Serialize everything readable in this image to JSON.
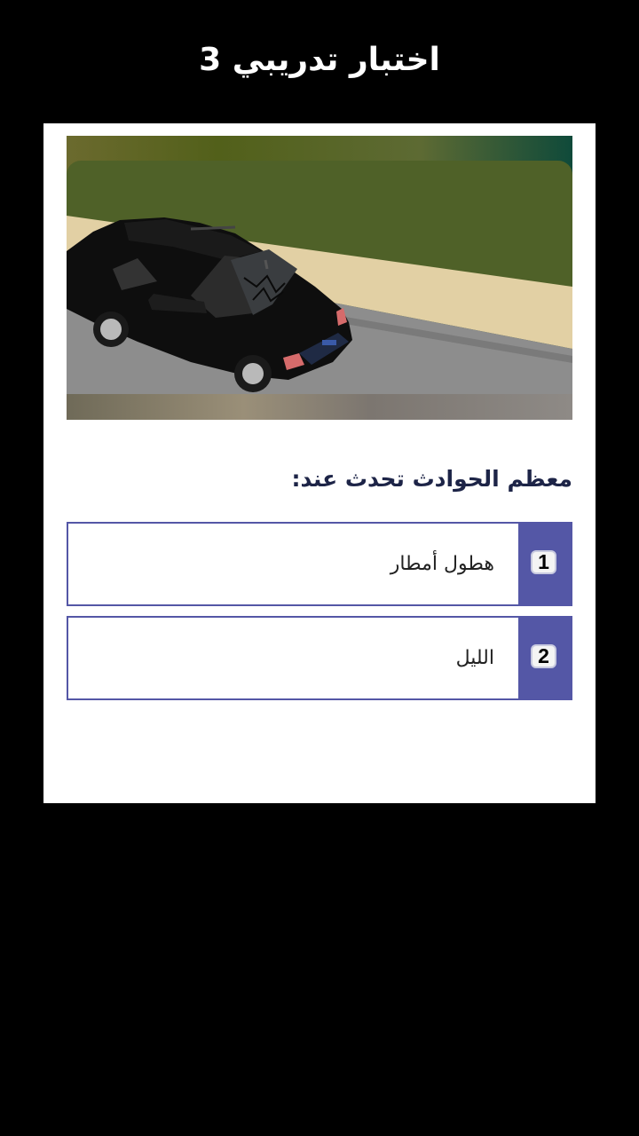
{
  "header": {
    "title": "اختبار تدريبي 3"
  },
  "quiz": {
    "illustration": "black-car-accident-cracked-windshield",
    "question": "معظم الحوادث تحدث عند:",
    "answers": [
      {
        "number": "1",
        "text": "هطول أمطار"
      },
      {
        "number": "2",
        "text": "الليل"
      }
    ]
  },
  "colors": {
    "background": "#000000",
    "card": "#ffffff",
    "accent": "#5457a6",
    "question_text": "#1d2447"
  }
}
